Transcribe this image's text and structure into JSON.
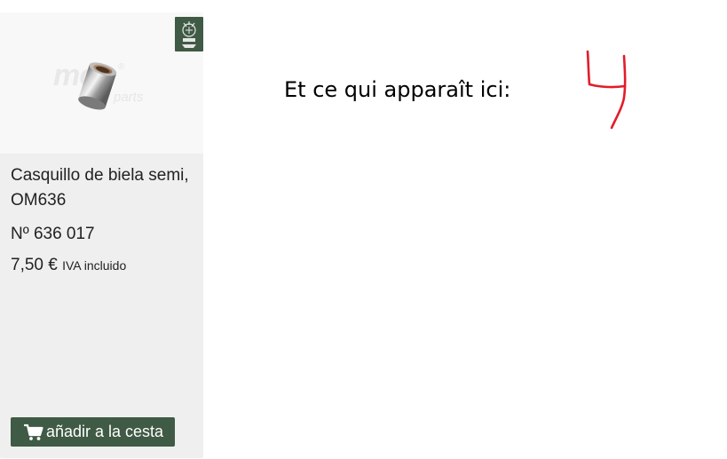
{
  "product_card": {
    "image_watermark": "mc",
    "image_watermark_reg": "®",
    "image_watermark_sub": "parts",
    "brand_badge_icon": "brand-emblem-icon",
    "name_line1": "Casquillo de biela semi,",
    "name_line2": "OM636",
    "reference": "Nº 636 017",
    "price": "7,50 €",
    "tax_note": "IVA incluido",
    "add_to_cart_label": "añadir a la cesta",
    "cart_icon": "shopping-cart-icon",
    "accent_color": "#3f5a45"
  },
  "annotation": {
    "text": "Et ce qui apparaît ici:",
    "number": "4",
    "number_color": "#e11d2a"
  }
}
